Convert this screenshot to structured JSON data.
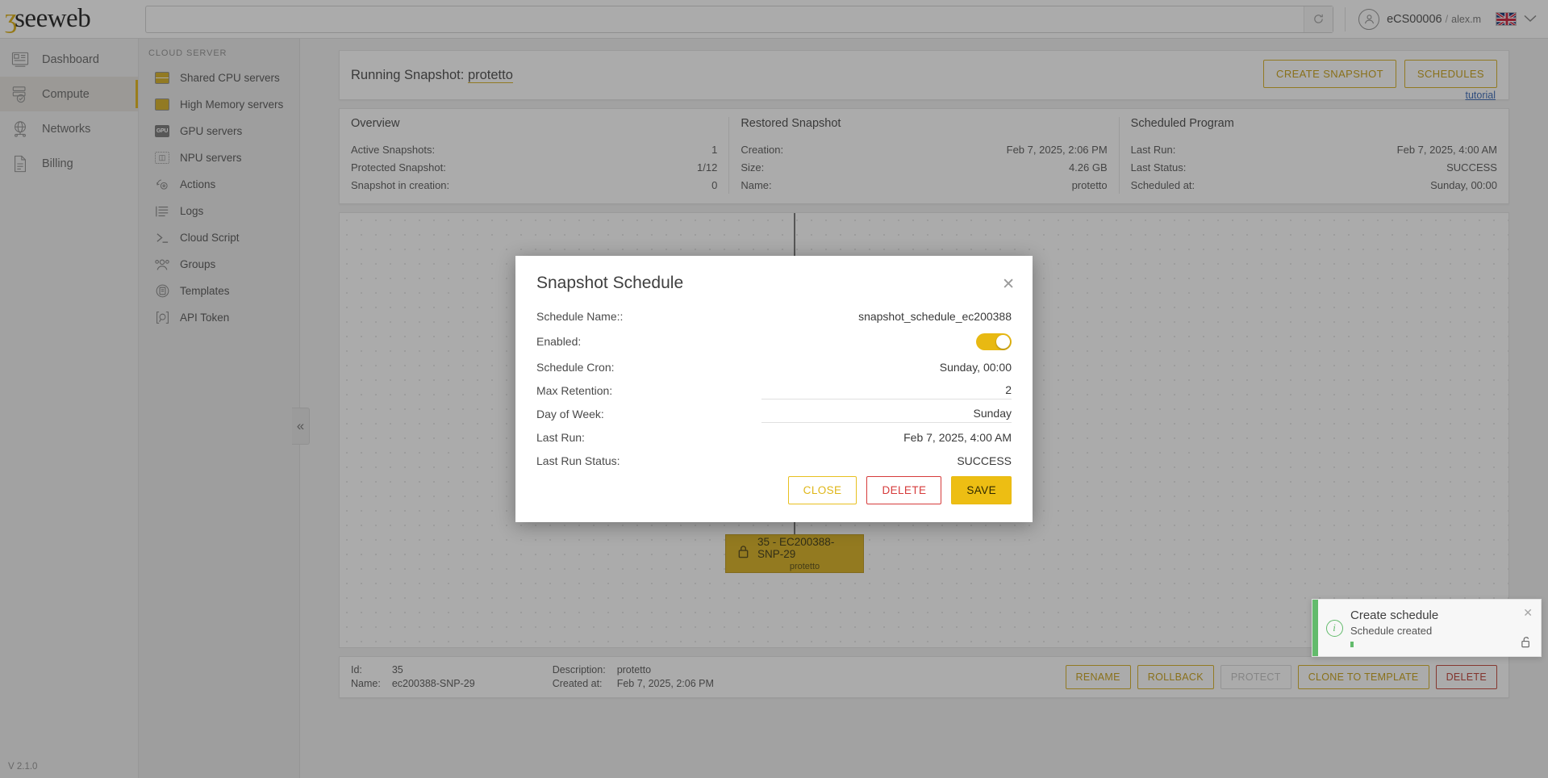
{
  "brand": {
    "name": "seeweb",
    "accent": "#d4ab16"
  },
  "topbar": {
    "search_placeholder": "",
    "search_value": "",
    "refresh_icon": "refresh-icon",
    "account": "eCS00006",
    "separator": "/",
    "username": "alex.m",
    "language_flag": "uk-flag-icon",
    "chevron": "⌄"
  },
  "leftnav": {
    "items": [
      {
        "label": "Dashboard",
        "icon": "dashboard-icon",
        "active": false
      },
      {
        "label": "Compute",
        "icon": "server-icon",
        "active": true
      },
      {
        "label": "Networks",
        "icon": "globe-icon",
        "active": false
      },
      {
        "label": "Billing",
        "icon": "document-icon",
        "active": false
      }
    ],
    "version": "V 2.1.0"
  },
  "subnav": {
    "title": "CLOUD SERVER",
    "items": [
      {
        "label": "Shared CPU servers",
        "icon": "cpu-chip-icon"
      },
      {
        "label": "High Memory servers",
        "icon": "memory-chip-icon"
      },
      {
        "label": "GPU servers",
        "icon": "gpu-chip-icon"
      },
      {
        "label": "NPU servers",
        "icon": "npu-chip-icon"
      },
      {
        "label": "Actions",
        "icon": "actions-gear-icon"
      },
      {
        "label": "Logs",
        "icon": "logs-list-icon"
      },
      {
        "label": "Cloud Script",
        "icon": "terminal-icon"
      },
      {
        "label": "Groups",
        "icon": "groups-people-icon"
      },
      {
        "label": "Templates",
        "icon": "templates-icon"
      },
      {
        "label": "API Token",
        "icon": "api-token-icon"
      }
    ],
    "collapse_icon": "«"
  },
  "header": {
    "title_prefix": "Running Snapshot:",
    "snapshot_name": "protetto",
    "create_snapshot_label": "CREATE SNAPSHOT",
    "schedules_label": "SCHEDULES",
    "tutorial_label": "tutorial"
  },
  "info": {
    "overview": {
      "heading": "Overview",
      "rows": [
        {
          "key": "Active Snapshots:",
          "value": "1"
        },
        {
          "key": "Protected Snapshot:",
          "value": "1/12"
        },
        {
          "key": "Snapshot in creation:",
          "value": "0"
        }
      ]
    },
    "restored": {
      "heading": "Restored Snapshot",
      "rows": [
        {
          "key": "Creation:",
          "value": "Feb 7, 2025, 2:06 PM"
        },
        {
          "key": "Size:",
          "value": "4.26 GB"
        },
        {
          "key": "Name:",
          "value": "protetto"
        }
      ]
    },
    "scheduled": {
      "heading": "Scheduled Program",
      "rows": [
        {
          "key": "Last Run:",
          "value": "Feb 7, 2025, 4:00 AM"
        },
        {
          "key": "Last Status:",
          "value": "SUCCESS"
        },
        {
          "key": "Scheduled at:",
          "value": "Sunday, 00:00"
        }
      ]
    }
  },
  "tree": {
    "node": {
      "lock_icon": "lock-icon",
      "title": "35 - EC200388-SNP-29",
      "subtitle": "protetto"
    }
  },
  "bottom": {
    "id_key": "Id:",
    "id_value": "35",
    "name_key": "Name:",
    "name_value": "ec200388-SNP-29",
    "description_key": "Description:",
    "description_value": "protetto",
    "created_key": "Created at:",
    "created_value": "Feb 7, 2025, 2:06 PM",
    "buttons": [
      {
        "label": "RENAME",
        "state": "normal"
      },
      {
        "label": "ROLLBACK",
        "state": "normal"
      },
      {
        "label": "PROTECT",
        "state": "disabled"
      },
      {
        "label": "CLONE TO TEMPLATE",
        "state": "normal"
      },
      {
        "label": "DELETE",
        "state": "danger"
      }
    ]
  },
  "modal": {
    "title": "Snapshot Schedule",
    "close_icon": "close-icon",
    "fields": {
      "schedule_name_label": "Schedule Name::",
      "schedule_name_value": "snapshot_schedule_ec200388",
      "enabled_label": "Enabled:",
      "enabled_value": true,
      "schedule_cron_label": "Schedule Cron:",
      "schedule_cron_value": "Sunday, 00:00",
      "max_retention_label": "Max Retention:",
      "max_retention_value": "2",
      "day_of_week_label": "Day of Week:",
      "day_of_week_value": "Sunday",
      "last_run_label": "Last Run:",
      "last_run_value": "Feb 7, 2025, 4:00 AM",
      "last_run_status_label": "Last Run Status:",
      "last_run_status_value": "SUCCESS"
    },
    "buttons": {
      "close": "CLOSE",
      "delete": "DELETE",
      "save": "SAVE"
    }
  },
  "toast": {
    "title": "Create schedule",
    "message": "Schedule created",
    "icon": "info-circle-icon",
    "close_icon": "close-icon",
    "unlock_icon": "unlock-icon",
    "accent": "#63bb6c"
  }
}
